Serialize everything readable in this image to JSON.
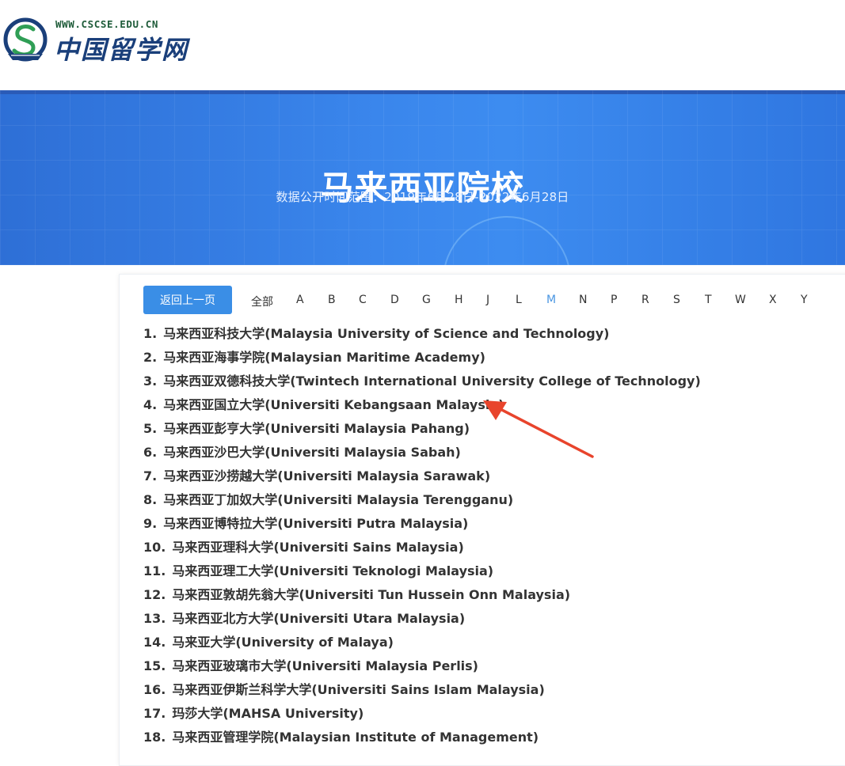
{
  "header": {
    "logo_url_text": "WWW.CSCSE.EDU.CN",
    "logo_name": "中国留学网"
  },
  "banner": {
    "title": "马来西亚院校",
    "subtitle": "数据公开时间范围：2019年6月28日-2022年6月28日"
  },
  "toolbar": {
    "back_label": "返回上一页"
  },
  "filter": {
    "all_label": "全部",
    "letters": [
      "A",
      "B",
      "C",
      "D",
      "G",
      "H",
      "J",
      "L",
      "M",
      "N",
      "P",
      "R",
      "S",
      "T",
      "W",
      "X",
      "Y"
    ],
    "active": "M"
  },
  "schools": [
    {
      "num": "1.",
      "name": "马来西亚科技大学(Malaysia University of Science and Technology)"
    },
    {
      "num": "2.",
      "name": "马来西亚海事学院(Malaysian Maritime Academy)"
    },
    {
      "num": "3.",
      "name": "马来西亚双德科技大学(Twintech International University College of Technology)"
    },
    {
      "num": "4.",
      "name": "马来西亚国立大学(Universiti Kebangsaan Malaysia)"
    },
    {
      "num": "5.",
      "name": "马来西亚彭亨大学(Universiti Malaysia Pahang)"
    },
    {
      "num": "6.",
      "name": "马来西亚沙巴大学(Universiti Malaysia Sabah)"
    },
    {
      "num": "7.",
      "name": "马来西亚沙捞越大学(Universiti Malaysia Sarawak)"
    },
    {
      "num": "8.",
      "name": "马来西亚丁加奴大学(Universiti Malaysia Terengganu)"
    },
    {
      "num": "9.",
      "name": "马来西亚博特拉大学(Universiti Putra Malaysia)"
    },
    {
      "num": "10.",
      "name": "马来西亚理科大学(Universiti Sains Malaysia)"
    },
    {
      "num": "11.",
      "name": "马来西亚理工大学(Universiti Teknologi Malaysia)"
    },
    {
      "num": "12.",
      "name": "马来西亚敦胡先翁大学(Universiti Tun Hussein Onn Malaysia)"
    },
    {
      "num": "13.",
      "name": "马来西亚北方大学(Universiti Utara Malaysia)"
    },
    {
      "num": "14.",
      "name": "马来亚大学(University of Malaya)"
    },
    {
      "num": "15.",
      "name": "马来西亚玻璃市大学(Universiti Malaysia Perlis)"
    },
    {
      "num": "16.",
      "name": "马来西亚伊斯兰科学大学(Universiti Sains Islam Malaysia)"
    },
    {
      "num": "17.",
      "name": "玛莎大学(MAHSA University)"
    },
    {
      "num": "18.",
      "name": "马来西亚管理学院(Malaysian Institute of Management)"
    }
  ],
  "colors": {
    "accent": "#3a8ee6",
    "active_letter": "#4a96e2",
    "annotation_arrow": "#e8442c"
  }
}
